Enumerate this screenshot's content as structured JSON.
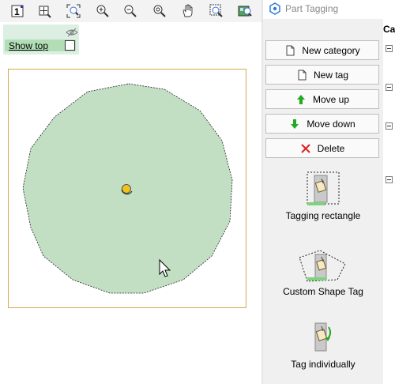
{
  "showtop": {
    "label": "Show top",
    "checked": false
  },
  "window": {
    "title": "Part Tagging"
  },
  "buttons": {
    "new_category": "New category",
    "new_tag": "New tag",
    "move_up": "Move up",
    "move_down": "Move down",
    "delete": "Delete"
  },
  "tools": {
    "tagging_rectangle": "Tagging rectangle",
    "custom_shape_tag": "Custom Shape Tag",
    "tag_individually": "Tag individually"
  },
  "tree": {
    "header": "Ca"
  },
  "colors": {
    "shape_fill": "#c2dfc4",
    "canvas_border": "#d6a84e",
    "accent_green": "#22aa22",
    "delete_red": "#e02020"
  },
  "toolbar_icons": [
    "page-one-icon",
    "zoom-fit-page-icon",
    "zoom-extents-icon",
    "zoom-in-icon",
    "zoom-out-icon",
    "zoom-reset-icon",
    "pan-hand-icon",
    "zoom-window-icon",
    "zoom-selection-icon"
  ]
}
